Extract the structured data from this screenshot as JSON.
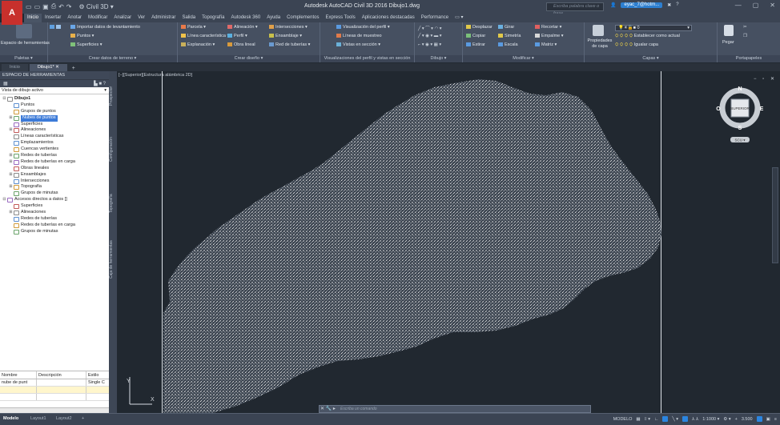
{
  "app": {
    "logo": "A",
    "qat_icons": [
      "new-icon",
      "open-icon",
      "save-icon",
      "print-icon",
      "undo-icon",
      "redo-icon"
    ],
    "workspace": "Civil 3D",
    "title": "Autodesk AutoCAD Civil 3D 2016   Dibujo1.dwg",
    "search_placeholder": "Escriba palabra clave o frase",
    "user": "eyac_7@hotm...",
    "window_controls": [
      "—",
      "▢",
      "✕"
    ]
  },
  "menu_tabs": [
    "Inicio",
    "Insertar",
    "Anotar",
    "Modificar",
    "Analizar",
    "Ver",
    "Administrar",
    "Salida",
    "Topografía",
    "Autodesk 360",
    "Ayuda",
    "Complementos",
    "Express Tools",
    "Aplicaciones destacadas",
    "Performance"
  ],
  "ribbon": {
    "paletas": {
      "big_label": "Espacio de herramientas",
      "title": "Paletas ▾"
    },
    "crear_terreno": {
      "items": [
        "Importar datos de levantamiento",
        "Puntos ▾",
        "Superficies ▾"
      ],
      "title": "Crear datos de terreno ▾"
    },
    "crear_diseno": {
      "items": [
        "Parcela ▾",
        "Línea característica ▾",
        "Explanación ▾",
        "Alineación ▾",
        "Perfil ▾",
        "Obra lineal",
        "Intersecciones ▾",
        "Ensamblaje ▾",
        "Red de tuberías ▾"
      ],
      "title": "Crear diseño ▾"
    },
    "perfil_vistas": {
      "items": [
        "Visualización del perfil ▾",
        "Líneas de muestreo",
        "Vistas en sección ▾"
      ],
      "title": "Visualizaciones del perfil y vistas en sección"
    },
    "dibujo": {
      "title": "Dibujo ▾"
    },
    "modificar": {
      "items": [
        "Desplazar",
        "Girar",
        "Recortar ▾",
        "Copiar",
        "Simetría",
        "Empalme ▾",
        "Estirar",
        "Escala",
        "Matriz ▾"
      ],
      "title": "Modificar ▾"
    },
    "capas": {
      "items": [
        "Propiedades de capa",
        "Establecer como actual",
        "Igualar capa"
      ],
      "layer_value": "0",
      "title": "Capas ▾"
    },
    "portapapeles": {
      "items": [
        "Pegar"
      ],
      "title": "Portapapeles"
    }
  },
  "doc_tabs": [
    "Inicio",
    "Dibujo1*"
  ],
  "toolspace": {
    "title": "ESPACIO DE HERRAMIENTAS",
    "view": "Vista de dibujo activo",
    "side_tabs": [
      "Prospector",
      "Configuración",
      "Topografía",
      "Caja de herramientas"
    ],
    "tree": [
      {
        "label": "Dibujo1",
        "level": 0,
        "exp": "⊟",
        "bold": true
      },
      {
        "label": "Puntos",
        "level": 1,
        "exp": ""
      },
      {
        "label": "Grupos de puntos",
        "level": 1,
        "exp": ""
      },
      {
        "label": "Nubes de puntos",
        "level": 1,
        "exp": "⊞",
        "selected": true
      },
      {
        "label": "Superficies",
        "level": 1,
        "exp": ""
      },
      {
        "label": "Alineaciones",
        "level": 1,
        "exp": "⊞"
      },
      {
        "label": "Líneas características",
        "level": 1,
        "exp": ""
      },
      {
        "label": "Emplazamientos",
        "level": 1,
        "exp": ""
      },
      {
        "label": "Cuencas vertientes",
        "level": 1,
        "exp": ""
      },
      {
        "label": "Redes de tuberías",
        "level": 1,
        "exp": "⊞"
      },
      {
        "label": "Redes de tuberías en carga",
        "level": 1,
        "exp": "⊞"
      },
      {
        "label": "Obras lineales",
        "level": 1,
        "exp": ""
      },
      {
        "label": "Ensamblajes",
        "level": 1,
        "exp": "⊞"
      },
      {
        "label": "Intersecciones",
        "level": 1,
        "exp": ""
      },
      {
        "label": "Topografía",
        "level": 1,
        "exp": "⊞"
      },
      {
        "label": "Grupos de minutas",
        "level": 1,
        "exp": ""
      },
      {
        "label": "Accesos directos a datos []",
        "level": 0,
        "exp": "⊟"
      },
      {
        "label": "Superficies",
        "level": 1,
        "exp": ""
      },
      {
        "label": "Alineaciones",
        "level": 1,
        "exp": "⊞"
      },
      {
        "label": "Redes de tuberías",
        "level": 1,
        "exp": ""
      },
      {
        "label": "Redes de tuberías en carga",
        "level": 1,
        "exp": ""
      },
      {
        "label": "Grupos de minutas",
        "level": 1,
        "exp": ""
      }
    ],
    "grid_headers": [
      "Nombre",
      "Descripción",
      "Estilo"
    ],
    "grid_rows": [
      [
        "nube de punt",
        "",
        "Single C"
      ]
    ]
  },
  "viewport": {
    "label": "[−][Superior][Estructura alámbrica 2D]",
    "controls": "− ▫ ✕",
    "viewcube": {
      "n": "N",
      "s": "S",
      "e": "E",
      "o": "O",
      "face": "SUPERIOR",
      "ucs": "SCU ▾"
    },
    "ucs_y": "Y",
    "ucs_x": "X",
    "cmd_placeholder": "Escriba un comando"
  },
  "status": {
    "layouts": [
      "Modelo",
      "Layout1",
      "Layout2"
    ],
    "model": "MODELO",
    "scale": "1:1000 ▾",
    "value": "3.500"
  }
}
